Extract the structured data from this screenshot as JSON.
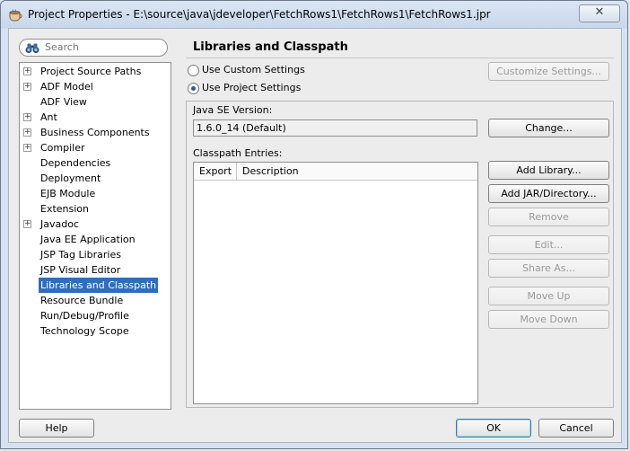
{
  "window": {
    "title": "Project Properties - E:\\source\\java\\jdeveloper\\FetchRows1\\FetchRows1\\FetchRows1.jpr",
    "close_symbol": "✕"
  },
  "search": {
    "placeholder": "Search"
  },
  "tree": {
    "items": [
      {
        "label": "Project Source Paths",
        "expandable": true,
        "selected": false
      },
      {
        "label": "ADF Model",
        "expandable": true,
        "selected": false
      },
      {
        "label": "ADF View",
        "expandable": false,
        "selected": false
      },
      {
        "label": "Ant",
        "expandable": true,
        "selected": false
      },
      {
        "label": "Business Components",
        "expandable": true,
        "selected": false
      },
      {
        "label": "Compiler",
        "expandable": true,
        "selected": false
      },
      {
        "label": "Dependencies",
        "expandable": false,
        "selected": false
      },
      {
        "label": "Deployment",
        "expandable": false,
        "selected": false
      },
      {
        "label": "EJB Module",
        "expandable": false,
        "selected": false
      },
      {
        "label": "Extension",
        "expandable": false,
        "selected": false
      },
      {
        "label": "Javadoc",
        "expandable": true,
        "selected": false
      },
      {
        "label": "Java EE Application",
        "expandable": false,
        "selected": false
      },
      {
        "label": "JSP Tag Libraries",
        "expandable": false,
        "selected": false
      },
      {
        "label": "JSP Visual Editor",
        "expandable": false,
        "selected": false
      },
      {
        "label": "Libraries and Classpath",
        "expandable": false,
        "selected": true
      },
      {
        "label": "Resource Bundle",
        "expandable": false,
        "selected": false
      },
      {
        "label": "Run/Debug/Profile",
        "expandable": false,
        "selected": false
      },
      {
        "label": "Technology Scope",
        "expandable": false,
        "selected": false
      }
    ]
  },
  "panel": {
    "title": "Libraries and Classpath",
    "use_custom_label": "Use Custom Settings",
    "use_project_label": "Use Project Settings",
    "customize_label": "Customize Settings...",
    "java_se_label": "Java SE Version:",
    "java_se_value": "1.6.0_14 (Default)",
    "change_label": "Change...",
    "classpath_label": "Classpath Entries:",
    "columns": [
      "Export",
      "Description"
    ],
    "add_library_label": "Add Library...",
    "add_jar_label": "Add JAR/Directory...",
    "remove_label": "Remove",
    "edit_label": "Edit...",
    "share_label": "Share As...",
    "move_up_label": "Move Up",
    "move_down_label": "Move Down"
  },
  "footer": {
    "help_label": "Help",
    "ok_label": "OK",
    "cancel_label": "Cancel"
  }
}
